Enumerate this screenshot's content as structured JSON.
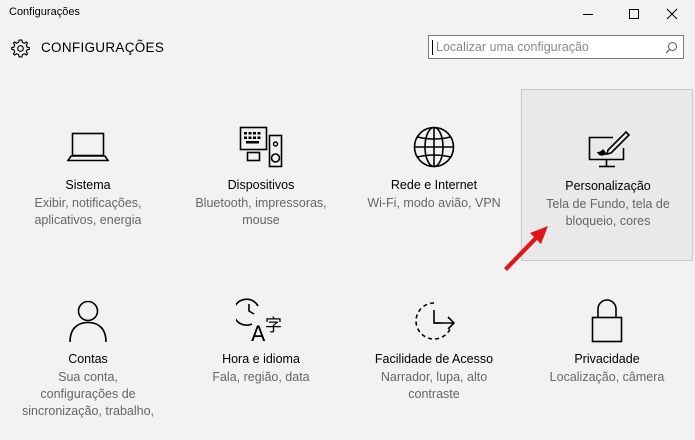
{
  "window": {
    "title": "Configurações",
    "controls": {
      "minimize": "minimize-icon",
      "maximize": "maximize-icon",
      "close": "close-icon"
    }
  },
  "header": {
    "icon": "gear-icon",
    "title": "CONFIGURAÇÕES",
    "search_placeholder": "Localizar uma configuração"
  },
  "tiles": [
    {
      "icon": "laptop-icon",
      "name": "Sistema",
      "desc1": "Exibir, notificações,",
      "desc2": "aplicativos, energia",
      "desc3": ""
    },
    {
      "icon": "devices-icon",
      "name": "Dispositivos",
      "desc1": "Bluetooth, impressoras,",
      "desc2": "mouse",
      "desc3": ""
    },
    {
      "icon": "globe-icon",
      "name": "Rede e Internet",
      "desc1": "Wi-Fi, modo avião, VPN",
      "desc2": "",
      "desc3": ""
    },
    {
      "icon": "personalization-icon",
      "name": "Personalização",
      "desc1": "Tela de Fundo, tela de",
      "desc2": "bloqueio, cores",
      "desc3": ""
    },
    {
      "icon": "person-icon",
      "name": "Contas",
      "desc1": "Sua conta,",
      "desc2": "configurações de",
      "desc3": "sincronização, trabalho,"
    },
    {
      "icon": "time-language-icon",
      "name": "Hora e idioma",
      "desc1": "Fala, região, data",
      "desc2": "",
      "desc3": ""
    },
    {
      "icon": "ease-of-access-icon",
      "name": "Facilidade de Acesso",
      "desc1": "Narrador, lupa, alto",
      "desc2": "contraste",
      "desc3": ""
    },
    {
      "icon": "lock-icon",
      "name": "Privacidade",
      "desc1": "Localização, câmera",
      "desc2": "",
      "desc3": ""
    }
  ],
  "colors": {
    "background": "#f2f2f2",
    "selected_tile": "#e9e9e9",
    "annotation_arrow": "#e0161b"
  }
}
